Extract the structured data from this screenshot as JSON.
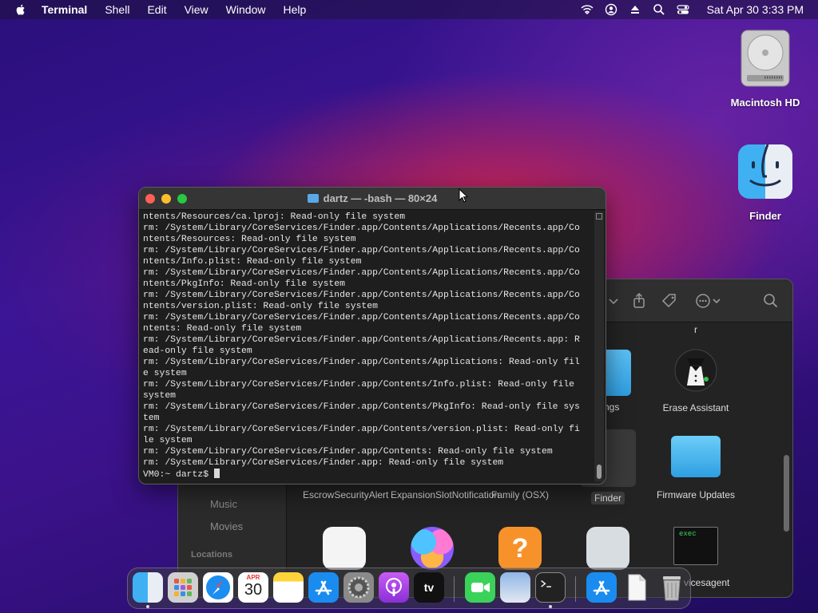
{
  "menubar": {
    "app_name": "Terminal",
    "menus": [
      "Shell",
      "Edit",
      "View",
      "Window",
      "Help"
    ],
    "status_icons": [
      "wifi-icon",
      "user-icon",
      "eject-icon",
      "search-icon",
      "control-center-icon"
    ],
    "clock": "Sat Apr 30  3:33 PM"
  },
  "desktop": {
    "icons": [
      {
        "label": "Macintosh HD",
        "icon": "hard-drive-icon"
      },
      {
        "label": "Finder",
        "icon": "finder-icon"
      }
    ]
  },
  "terminal": {
    "title": "dartz — -bash — 80×24",
    "lines": [
      "ntents/Resources/ca.lproj: Read-only file system",
      "rm: /System/Library/CoreServices/Finder.app/Contents/Applications/Recents.app/Co",
      "ntents/Resources: Read-only file system",
      "rm: /System/Library/CoreServices/Finder.app/Contents/Applications/Recents.app/Co",
      "ntents/Info.plist: Read-only file system",
      "rm: /System/Library/CoreServices/Finder.app/Contents/Applications/Recents.app/Co",
      "ntents/PkgInfo: Read-only file system",
      "rm: /System/Library/CoreServices/Finder.app/Contents/Applications/Recents.app/Co",
      "ntents/version.plist: Read-only file system",
      "rm: /System/Library/CoreServices/Finder.app/Contents/Applications/Recents.app/Co",
      "ntents: Read-only file system",
      "rm: /System/Library/CoreServices/Finder.app/Contents/Applications/Recents.app: R",
      "ead-only file system",
      "rm: /System/Library/CoreServices/Finder.app/Contents/Applications: Read-only fil",
      "e system",
      "rm: /System/Library/CoreServices/Finder.app/Contents/Info.plist: Read-only file",
      "system",
      "rm: /System/Library/CoreServices/Finder.app/Contents/PkgInfo: Read-only file sys",
      "tem",
      "rm: /System/Library/CoreServices/Finder.app/Contents/version.plist: Read-only fi",
      "le system",
      "rm: /System/Library/CoreServices/Finder.app/Contents: Read-only file system",
      "rm: /System/Library/CoreServices/Finder.app: Read-only file system"
    ],
    "prompt": "VM0:~ dartz$ "
  },
  "finder": {
    "sidebar": {
      "items": [
        "Music",
        "Movies"
      ],
      "section": "Locations"
    },
    "items": [
      {
        "label": "r",
        "icon": "truncated-item"
      },
      {
        "label": "dings",
        "icon": "folder-icon"
      },
      {
        "label": "Erase Assistant",
        "icon": "erase-assistant-icon"
      },
      {
        "label": "EscrowSecurityAlert",
        "icon": "app-icon"
      },
      {
        "label": "ExpansionSlotNotification",
        "icon": "app-icon"
      },
      {
        "label": "Family (OSX)",
        "icon": "app-icon"
      },
      {
        "label": "Finder",
        "icon": "finder-icon"
      },
      {
        "label": "Firmware Updates",
        "icon": "folder-icon"
      },
      {
        "label": "vicesagent",
        "icon": "exec-icon"
      },
      {
        "label": "exec",
        "icon": "exec-label"
      }
    ]
  },
  "dock": {
    "apps": [
      "Finder",
      "Launchpad",
      "Safari",
      "Calendar",
      "Notes",
      "App Store",
      "System Preferences",
      "Podcasts",
      "TV",
      "FaceTime",
      "Preview",
      "Terminal",
      "Downloads",
      "Document",
      "Trash"
    ],
    "calendar_month": "APR",
    "calendar_day": "30",
    "tv_label": "tv"
  }
}
